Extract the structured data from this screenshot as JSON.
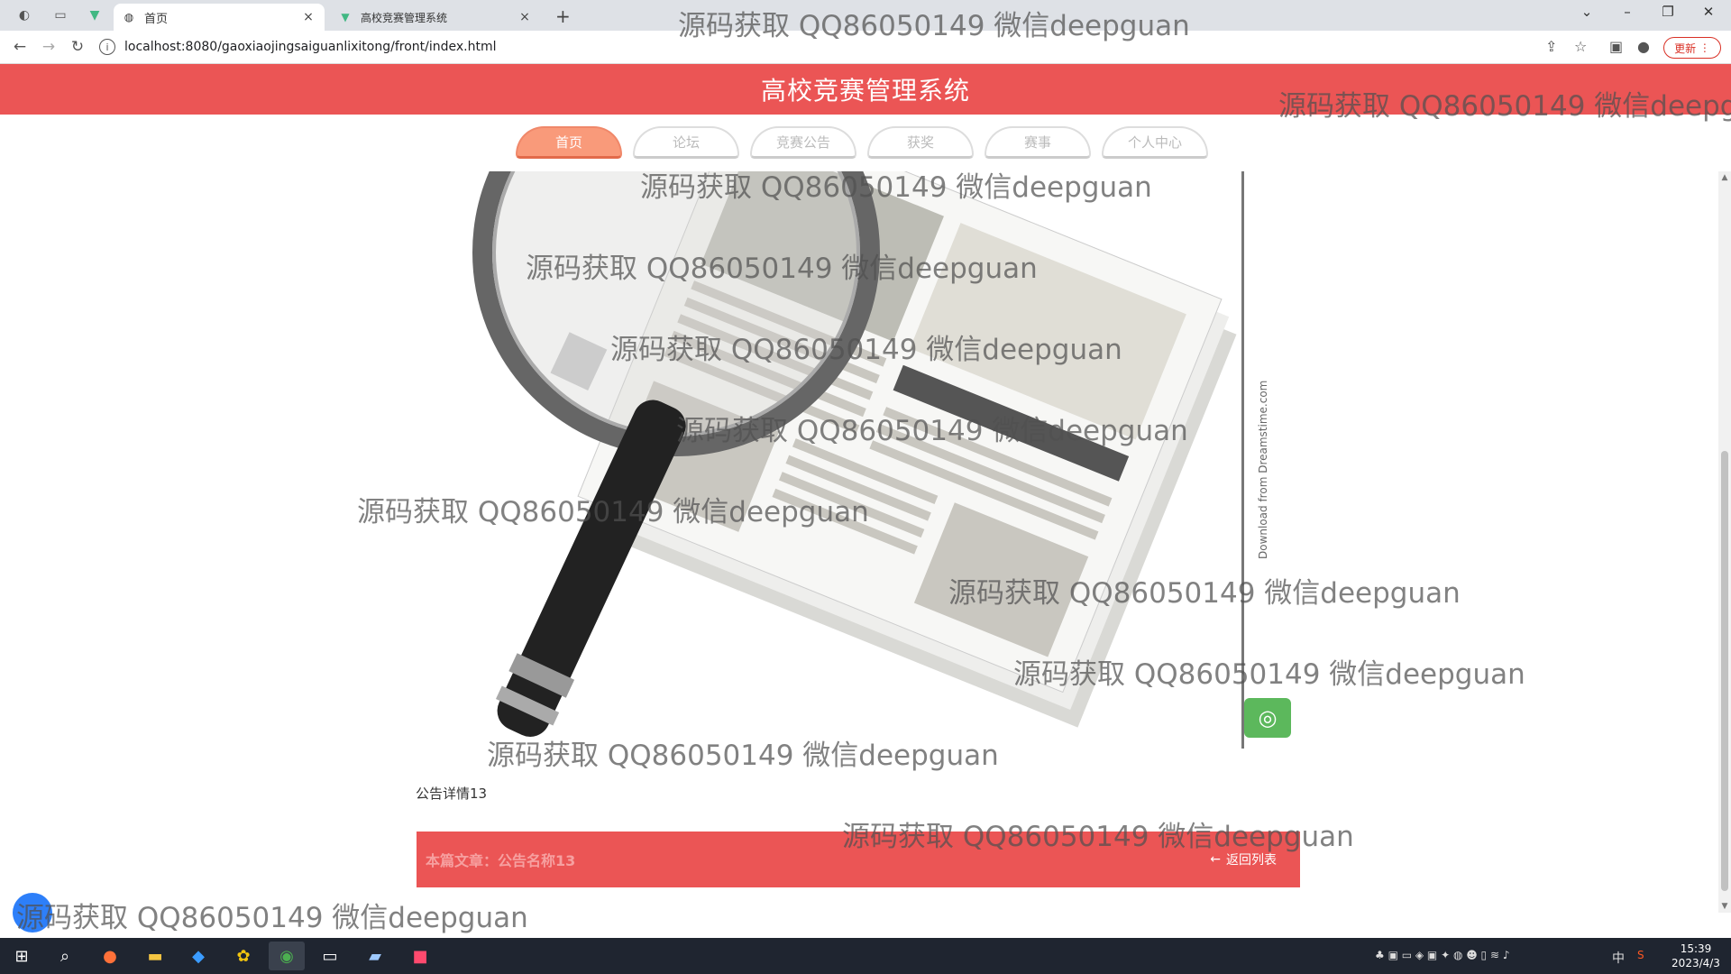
{
  "browser": {
    "tabs": [
      {
        "label": "首页",
        "active": true
      },
      {
        "label": "高校竞赛管理系统",
        "active": false
      }
    ],
    "url": "localhost:8080/gaoxiaojingsaiguanlixitong/front/index.html",
    "update_label": "更新"
  },
  "site": {
    "title": "高校竞赛管理系统",
    "menu": [
      {
        "label": "首页",
        "active": true
      },
      {
        "label": "论坛",
        "active": false
      },
      {
        "label": "竞赛公告",
        "active": false
      },
      {
        "label": "获奖",
        "active": false
      },
      {
        "label": "赛事",
        "active": false
      },
      {
        "label": "个人中心",
        "active": false
      }
    ]
  },
  "notice": {
    "title": "公告详情13",
    "article_label": "本篇文章：公告名称13",
    "back_label": "返回列表",
    "side_text": "Download from Dreamstime.com"
  },
  "watermark": {
    "text": "源码获取 QQ86050149 微信deepguan"
  },
  "taskbar": {
    "time": "15:39",
    "date": "2023/4/3",
    "ime": "中"
  },
  "colors": {
    "header": "#eb5555",
    "menu_active": "#f99a7a"
  }
}
